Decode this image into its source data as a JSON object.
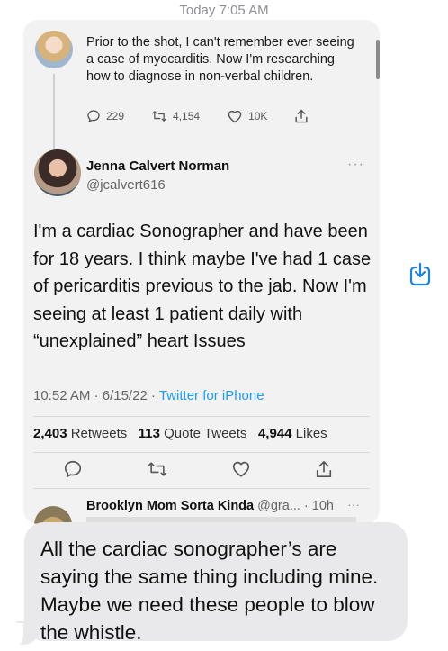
{
  "header": {
    "timestamp": "Today 7:05 AM"
  },
  "reply_tweet": {
    "text": "Prior to the shot, I can't remember ever seeing a case of myocarditis. Now I'm researching how to diagnose in non-verbal children.",
    "replies": "229",
    "retweets": "4,154",
    "likes": "10K"
  },
  "main_tweet": {
    "display_name": "Jenna Calvert Norman",
    "handle": "@jcalvert616",
    "more": "···",
    "text": "I'm a cardiac Sonographer and have been for 18 years. I think maybe I've had 1 case of pericarditis previous to the jab. Now I'm seeing at least 1 patient daily with “unexplained” heart Issues",
    "time": "10:52 AM",
    "date": "6/15/22",
    "source": "Twitter for iPhone",
    "retweets_count": "2,403",
    "retweets_label": "Retweets",
    "quote_count": "113",
    "quote_label": "Quote Tweets",
    "likes_count": "4,944",
    "likes_label": "Likes"
  },
  "next_reply": {
    "display_name": "Brooklyn Mom Sorta Kinda",
    "handle": "@gra...",
    "time": "10h",
    "more": "···"
  },
  "message": {
    "text": "All the cardiac sonographer’s are saying the same thing including mine. Maybe we need these people to blow the whistle."
  },
  "icons": {
    "reply": "reply-icon",
    "retweet": "retweet-icon",
    "like": "heart-icon",
    "share": "share-icon",
    "save": "download-to-files-icon"
  },
  "colors": {
    "link": "#1d9bf0",
    "share_button": "#1a82e2",
    "bubble": "#e9e9eb",
    "card": "#f2f2f2"
  }
}
